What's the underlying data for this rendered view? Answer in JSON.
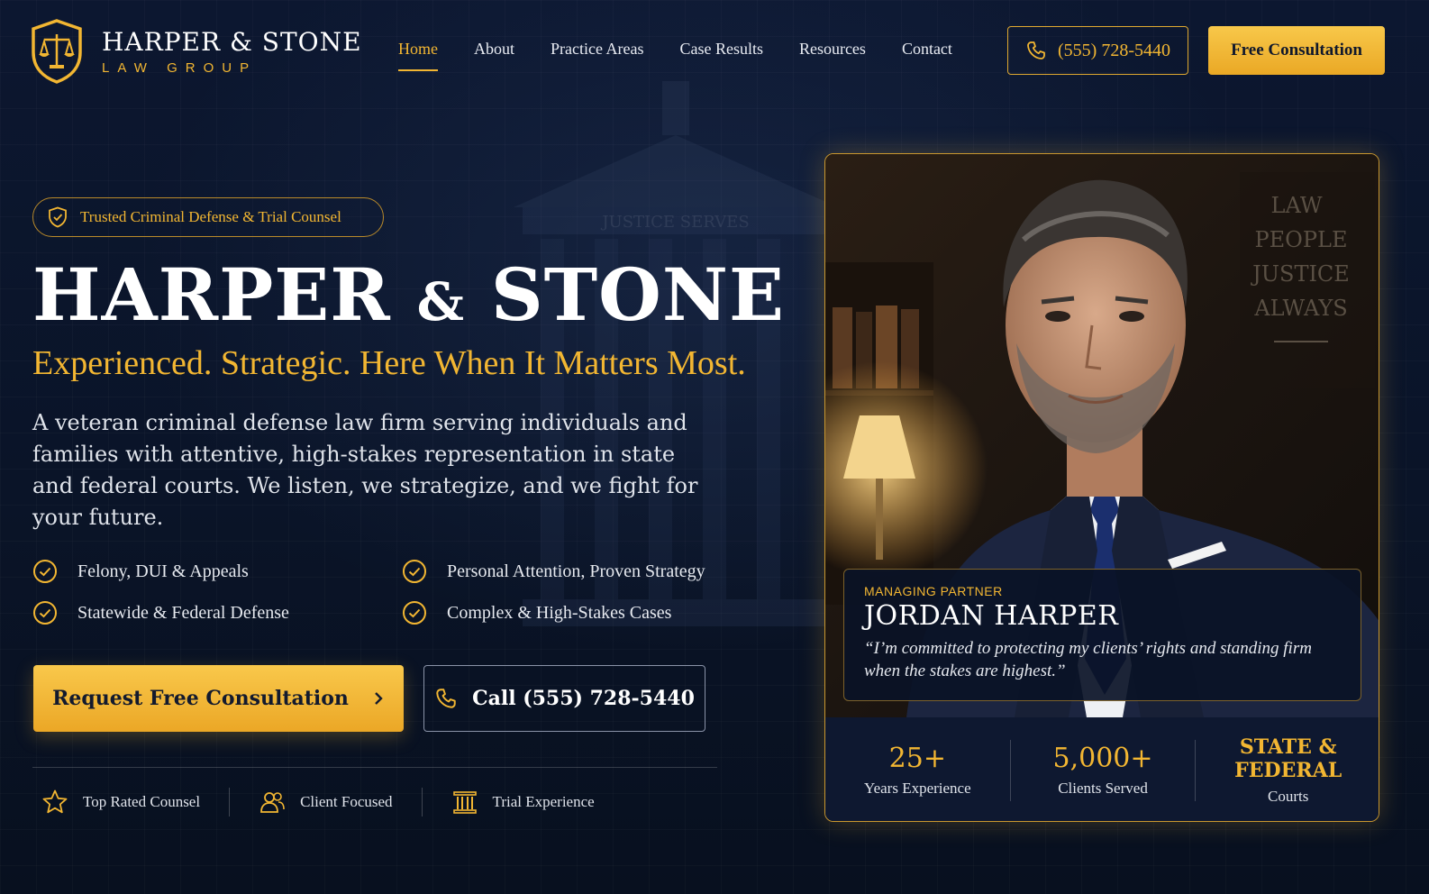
{
  "brand": {
    "name": "HARPER & STONE",
    "sub": "LAW GROUP"
  },
  "nav": {
    "items": [
      {
        "label": "Home",
        "active": true
      },
      {
        "label": "About"
      },
      {
        "label": "Practice Areas"
      },
      {
        "label": "Case Results"
      },
      {
        "label": "Resources"
      },
      {
        "label": "Contact"
      }
    ]
  },
  "header": {
    "phone": "(555) 728-5440",
    "consult_label": "Free Consultation"
  },
  "hero": {
    "badge": "Trusted Criminal Defense & Trial Counsel",
    "title_a": "HARPER",
    "title_amp": "&",
    "title_b": "STONE",
    "tagline": "Experienced. Strategic. Here When It Matters Most.",
    "description": "A veteran criminal defense law firm serving individuals and families with attentive, high-stakes representation in state and federal courts. We listen, we strategize, and we fight for your future.",
    "features": [
      "Felony, DUI & Appeals",
      "Personal Attention, Proven Strategy",
      "Statewide & Federal Defense",
      "Complex & High-Stakes Cases"
    ],
    "cta_primary": "Request Free Consultation",
    "cta_secondary": "Call (555) 728-5440",
    "trust": [
      {
        "label": "Top Rated Counsel",
        "icon": "star-icon"
      },
      {
        "label": "Client Focused",
        "icon": "users-icon"
      },
      {
        "label": "Trial Experience",
        "icon": "courthouse-icon"
      }
    ]
  },
  "profile": {
    "role": "MANAGING PARTNER",
    "name": "JORDAN HARPER",
    "quote": "“I’m committed to protecting my clients’ rights and standing firm when the stakes are highest.”",
    "wall_text": [
      "LAW",
      "PEOPLE",
      "JUSTICE",
      "ALWAYS"
    ],
    "stats": [
      {
        "value": "25+",
        "label": "Years Experience"
      },
      {
        "value": "5,000+",
        "label": "Clients Served"
      },
      {
        "value": "STATE & FEDERAL",
        "label": "Courts"
      }
    ]
  },
  "background": {
    "inscription": "JUSTICE SERVES"
  },
  "colors": {
    "accent": "#f2b632",
    "navy": "#0a1428"
  }
}
